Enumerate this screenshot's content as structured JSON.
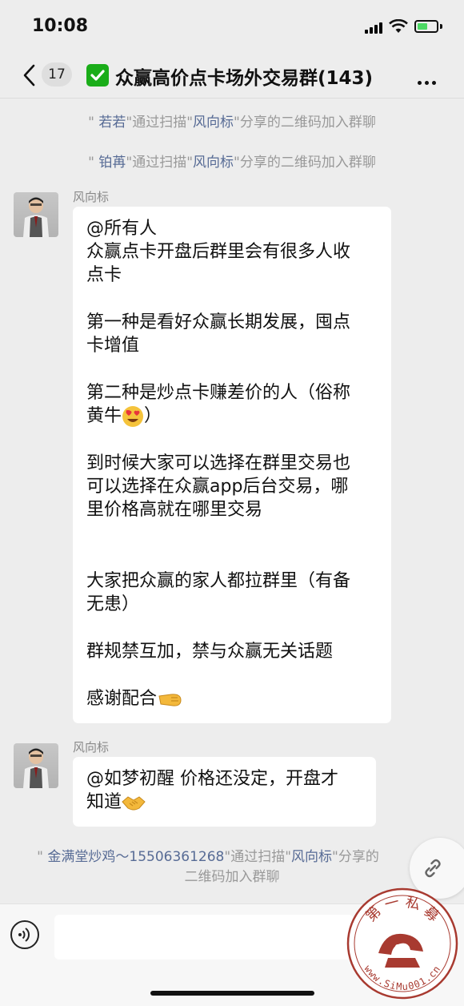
{
  "status_bar": {
    "time": "10:08"
  },
  "nav": {
    "unread_count": "17",
    "title": "众赢高价点卡场外交易群(143)"
  },
  "system_messages": [
    {
      "pre": "\" ",
      "user": "若若",
      "mid": "\"通过扫描\"",
      "target": "风向标",
      "post": "\"分享的二维码加入群聊"
    },
    {
      "pre": "\" ",
      "user": "铂苒",
      "mid": "\"通过扫描\"",
      "target": "风向标",
      "post": "\"分享的二维码加入群聊"
    },
    {
      "pre": "\" ",
      "user": "金满堂炒鸡～15506361268",
      "mid": "\"通过扫描\"",
      "target": "风向标",
      "post": "\"分享的",
      "line2": "二维码加入群聊"
    }
  ],
  "messages": [
    {
      "sender": "风向标",
      "lines": [
        "@所有人",
        "众赢点卡开盘后群里会有很多人收",
        "点卡",
        "第一种是看好众赢长期发展，囤点",
        "卡增值",
        "第二种是炒点卡赚差价的人（俗称",
        "黄牛",
        "）",
        "到时候大家可以选择在群里交易也",
        "可以选择在众赢app后台交易，哪",
        "里价格高就在哪里交易",
        "大家把众赢的家人都拉群里（有备",
        "无患）",
        "群规禁互加，禁与众赢无关话题",
        "感谢配合"
      ]
    },
    {
      "sender": "风向标",
      "lines": [
        "@如梦初醒 价格还没定，开盘才",
        "知道"
      ]
    }
  ],
  "input": {
    "value": ""
  },
  "watermark": {
    "top_text": "第 一 私 募",
    "bottom_text": "www.SiMu001.cn"
  },
  "colors": {
    "background": "#ededed",
    "link": "#576b95",
    "system_text": "#999999",
    "bubble": "#ffffff",
    "accent_green": "#1aad19",
    "watermark_red": "#a83a30"
  }
}
